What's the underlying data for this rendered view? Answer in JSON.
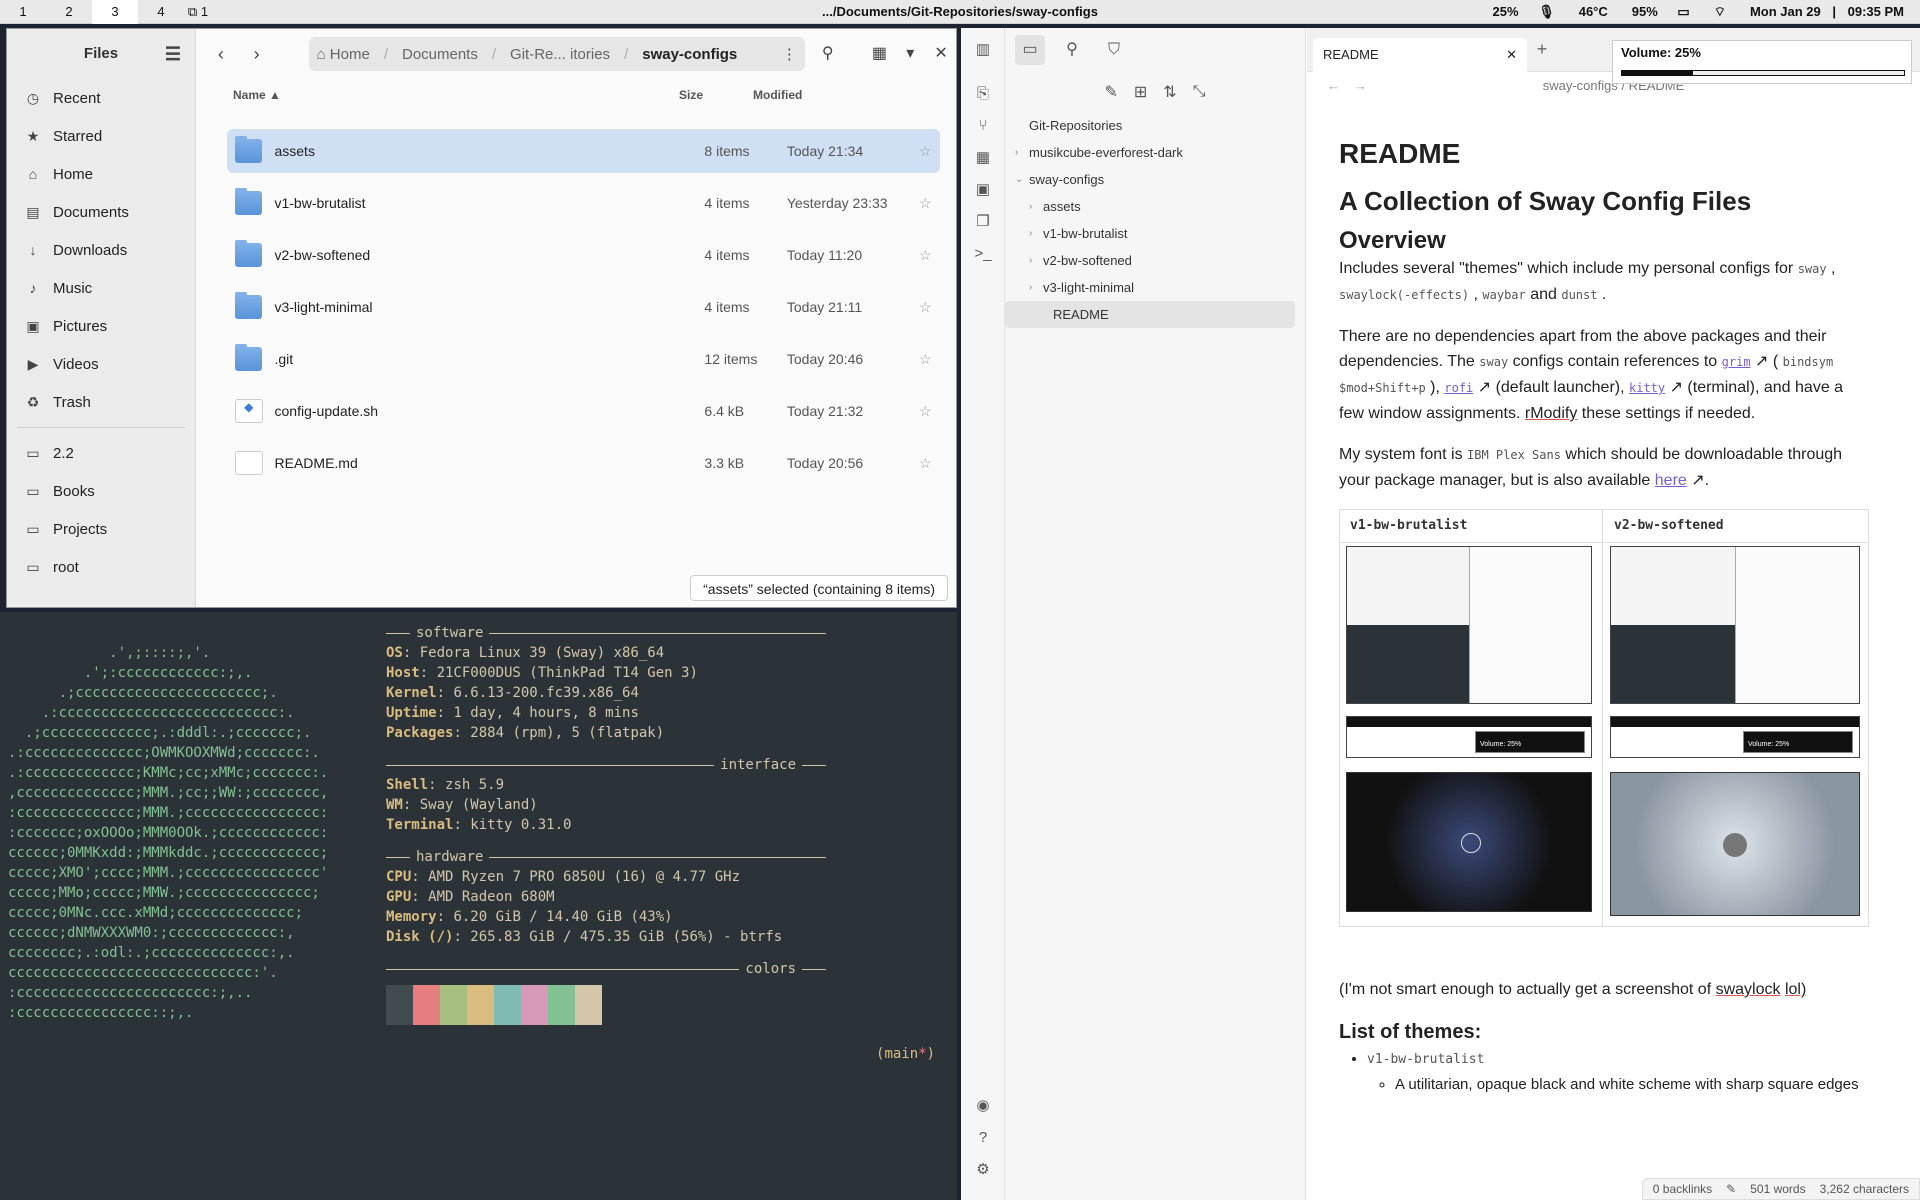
{
  "topbar": {
    "workspaces": [
      "1",
      "2",
      "3",
      "4"
    ],
    "active_workspace": "3",
    "scratch": "1",
    "window_title": ".../Documents/Git-Repositories/sway-configs",
    "volume": "25%",
    "temp": "46°C",
    "battery": "95%",
    "date": "Mon Jan 29",
    "time": "09:35 PM"
  },
  "files": {
    "title": "Files",
    "sidebar": [
      {
        "label": "Recent",
        "icon": "clock-icon"
      },
      {
        "label": "Starred",
        "icon": "star-icon"
      },
      {
        "label": "Home",
        "icon": "home-icon"
      },
      {
        "label": "Documents",
        "icon": "document-icon"
      },
      {
        "label": "Downloads",
        "icon": "download-icon"
      },
      {
        "label": "Music",
        "icon": "music-icon"
      },
      {
        "label": "Pictures",
        "icon": "picture-icon"
      },
      {
        "label": "Videos",
        "icon": "video-icon"
      },
      {
        "label": "Trash",
        "icon": "trash-icon"
      }
    ],
    "bookmarks": [
      "2.2",
      "Books",
      "Projects",
      "root"
    ],
    "path": [
      "Home",
      "Documents",
      "Git-Re... itories",
      "sway-configs"
    ],
    "columns": {
      "name": "Name",
      "size": "Size",
      "modified": "Modified"
    },
    "rows": [
      {
        "name": "assets",
        "size": "8 items",
        "modified": "Today 21:34",
        "type": "folder"
      },
      {
        "name": "v1-bw-brutalist",
        "size": "4 items",
        "modified": "Yesterday 23:33",
        "type": "folder"
      },
      {
        "name": "v2-bw-softened",
        "size": "4 items",
        "modified": "Today 11:20",
        "type": "folder"
      },
      {
        "name": "v3-light-minimal",
        "size": "4 items",
        "modified": "Today 21:11",
        "type": "folder"
      },
      {
        "name": ".git",
        "size": "12 items",
        "modified": "Today 20:46",
        "type": "folder"
      },
      {
        "name": "config-update.sh",
        "size": "6.4 kB",
        "modified": "Today 21:32",
        "type": "script"
      },
      {
        "name": "README.md",
        "size": "3.3 kB",
        "modified": "Today 20:56",
        "type": "text"
      }
    ],
    "status": "“assets” selected  (containing 8 items)"
  },
  "terminal": {
    "logo": [
      "            .',;::::;,'.",
      "         .';:cccccccccccc:;,.",
      "      .;cccccccccccccccccccccc;.",
      "    .:cccccccccccccccccccccccccc:.",
      "  .;ccccccccccccc;.:dddl:.;ccccccc;.",
      ".:cccccccccccccc;OWMKOOXMWd;ccccccc:.",
      ".:ccccccccccccc;KMMc;cc;xMMc;ccccccc:.",
      ",cccccccccccccc;MMM.;cc;;WW:;cccccccc,",
      ":cccccccccccccc;MMM.;cccccccccccccccc:",
      ":ccccccc;oxOOOo;MMM0OOk.;cccccccccccc:",
      "cccccc;0MMKxdd:;MMMkddc.;cccccccccccc;",
      "ccccc;XMO';cccc;MMM.;cccccccccccccccc'",
      "ccccc;MMo;ccccc;MMW.;ccccccccccccccc;",
      "ccccc;0MNc.ccc.xMMd;cccccccccccccc;",
      "cccccc;dNMWXXXWM0:;ccccccccccccc:,",
      "cccccccc;.:odl:.;cccccccccccccc:,.",
      "ccccccccccccccccccccccccccccc:'.",
      ":ccccccccccccccccccccccc:;,..",
      ":cccccccccccccccc::;,."
    ],
    "sections": {
      "software": "software",
      "interface": "interface",
      "hardware": "hardware",
      "colors": "colors"
    },
    "software": [
      {
        "k": "OS",
        "v": "Fedora Linux 39 (Sway) x86_64"
      },
      {
        "k": "Host",
        "v": "21CF000DUS (ThinkPad T14 Gen 3)"
      },
      {
        "k": "Kernel",
        "v": "6.6.13-200.fc39.x86_64"
      },
      {
        "k": "Uptime",
        "v": "1 day, 4 hours, 8 mins"
      },
      {
        "k": "Packages",
        "v": "2884 (rpm), 5 (flatpak)"
      }
    ],
    "interface": [
      {
        "k": "Shell",
        "v": "zsh 5.9"
      },
      {
        "k": "WM",
        "v": "Sway (Wayland)"
      },
      {
        "k": "Terminal",
        "v": "kitty 0.31.0"
      }
    ],
    "hardware": [
      {
        "k": "CPU",
        "v": "AMD Ryzen 7 PRO 6850U (16) @ 4.77 GHz"
      },
      {
        "k": "GPU",
        "v": "AMD Radeon 680M"
      },
      {
        "k": "Memory",
        "v": "6.20 GiB / 14.40 GiB (43%)"
      },
      {
        "k": "Disk (/)",
        "v": "265.83 GiB / 475.35 GiB (56%) - btrfs"
      }
    ],
    "swatch_colors": [
      "#414b50",
      "#e67e80",
      "#a7c080",
      "#dbbc7f",
      "#7fbbb3",
      "#d699b6",
      "#83c092",
      "#d3c6aa"
    ],
    "branch": "main",
    "branch_mark": "*"
  },
  "obsidian": {
    "root": "Git-Repositories",
    "tree": [
      {
        "label": "musikcube-everforest-dark",
        "level": 0,
        "chev": "›"
      },
      {
        "label": "sway-configs",
        "level": 0,
        "chev": "⌄"
      },
      {
        "label": "assets",
        "level": 1,
        "chev": "›"
      },
      {
        "label": "v1-bw-brutalist",
        "level": 1,
        "chev": "›"
      },
      {
        "label": "v2-bw-softened",
        "level": 1,
        "chev": "›"
      },
      {
        "label": "v3-light-minimal",
        "level": 1,
        "chev": "›"
      },
      {
        "label": "README",
        "level": 1,
        "chev": ""
      }
    ],
    "tab": "README",
    "breadcrumb": "sway-configs / README",
    "doc": {
      "h1": "README",
      "h2": "A Collection of Sway Config Files",
      "h3": "Overview",
      "p1a": "Includes several \"themes\" which include my personal configs for",
      "c_sway": "sway",
      "c_swaylock": "swaylock(-effects)",
      "c_waybar": "waybar",
      "and": "and",
      "c_dunst": "dunst",
      "p2a": "There are no dependencies apart from the above packages and their dependencies. The",
      "p2b": "configs contain references to",
      "grim": "grim",
      "bindsym": "bindsym $mod+Shift+p",
      "rofi": "rofi",
      "p2c": "(default launcher),",
      "kitty": "kitty",
      "p2d": "(terminal), and have a few window assignments.",
      "rmodify": "rModify",
      "p2e": "these settings if needed.",
      "p3a": "My system font is",
      "font": "IBM Plex Sans",
      "p3b": "which should be downloadable through your package manager, but is also available",
      "here": "here",
      "col1": "v1-bw-brutalist",
      "col2": "v2-bw-softened",
      "mini_vol": "Volume: 25%",
      "p4": "(I'm not smart enough to actually get a screenshot of",
      "swaylock_word": "swaylock",
      "lol": "lol)",
      "h4": "List of themes:",
      "li1": "v1-bw-brutalist",
      "li1a": "A utilitarian, opaque black and white scheme with sharp square edges"
    },
    "footer": {
      "backlinks": "0 backlinks",
      "words": "501 words",
      "chars": "3,262 characters"
    }
  },
  "volume_popup": {
    "label": "Volume: 25%",
    "level": 0.25
  }
}
